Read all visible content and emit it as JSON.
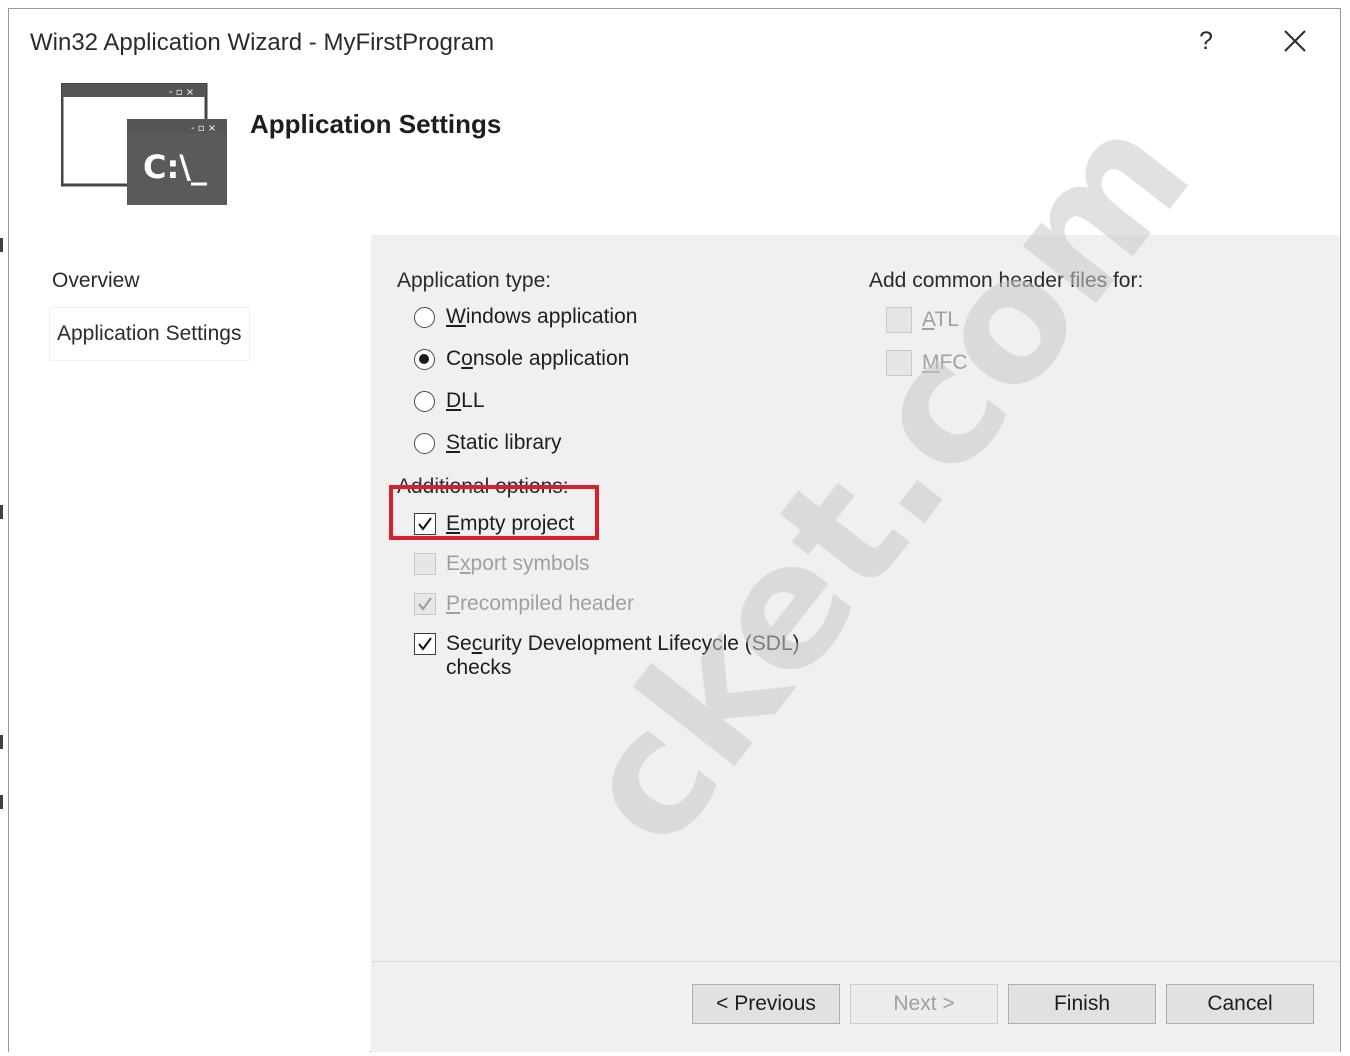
{
  "window": {
    "title": "Win32 Application Wizard - MyFirstProgram",
    "help_label": "?",
    "close_icon": "close-icon"
  },
  "header": {
    "title": "Application Settings",
    "logo_text": "C:\\_",
    "logo_icon": "console-window-icon"
  },
  "sidebar": {
    "items": [
      {
        "label": "Overview",
        "selected": false
      },
      {
        "label": "Application Settings",
        "selected": true
      }
    ]
  },
  "app_type": {
    "label": "Application type:",
    "options": [
      {
        "pre": "",
        "accel": "W",
        "post": "indows application",
        "selected": false
      },
      {
        "pre": "C",
        "accel": "o",
        "post": "nsole application",
        "selected": true
      },
      {
        "pre": "",
        "accel": "D",
        "post": "LL",
        "selected": false
      },
      {
        "pre": "",
        "accel": "S",
        "post": "tatic library",
        "selected": false
      }
    ]
  },
  "additional": {
    "label": "Additional options:",
    "options": [
      {
        "pre": "",
        "accel": "E",
        "post": "mpty project",
        "checked": true,
        "enabled": true
      },
      {
        "pre": "E",
        "accel": "x",
        "post": "port symbols",
        "checked": false,
        "enabled": false
      },
      {
        "pre": "",
        "accel": "P",
        "post": "recompiled header",
        "checked": true,
        "enabled": false
      },
      {
        "pre": "Se",
        "accel": "c",
        "post": "urity Development Lifecycle (SDL)",
        "post2": "checks",
        "checked": true,
        "enabled": true
      }
    ]
  },
  "headers": {
    "label": "Add common header files for:",
    "options": [
      {
        "pre": "",
        "accel": "A",
        "post": "TL",
        "checked": false,
        "enabled": false
      },
      {
        "pre": "",
        "accel": "M",
        "post": "FC",
        "checked": false,
        "enabled": false
      }
    ]
  },
  "buttons": {
    "previous": "< Previous",
    "next": "Next >",
    "finish": "Finish",
    "cancel": "Cancel"
  },
  "watermark": "cket.com",
  "colors": {
    "highlight": "#d7202b",
    "panel": "#f0f0f0"
  }
}
